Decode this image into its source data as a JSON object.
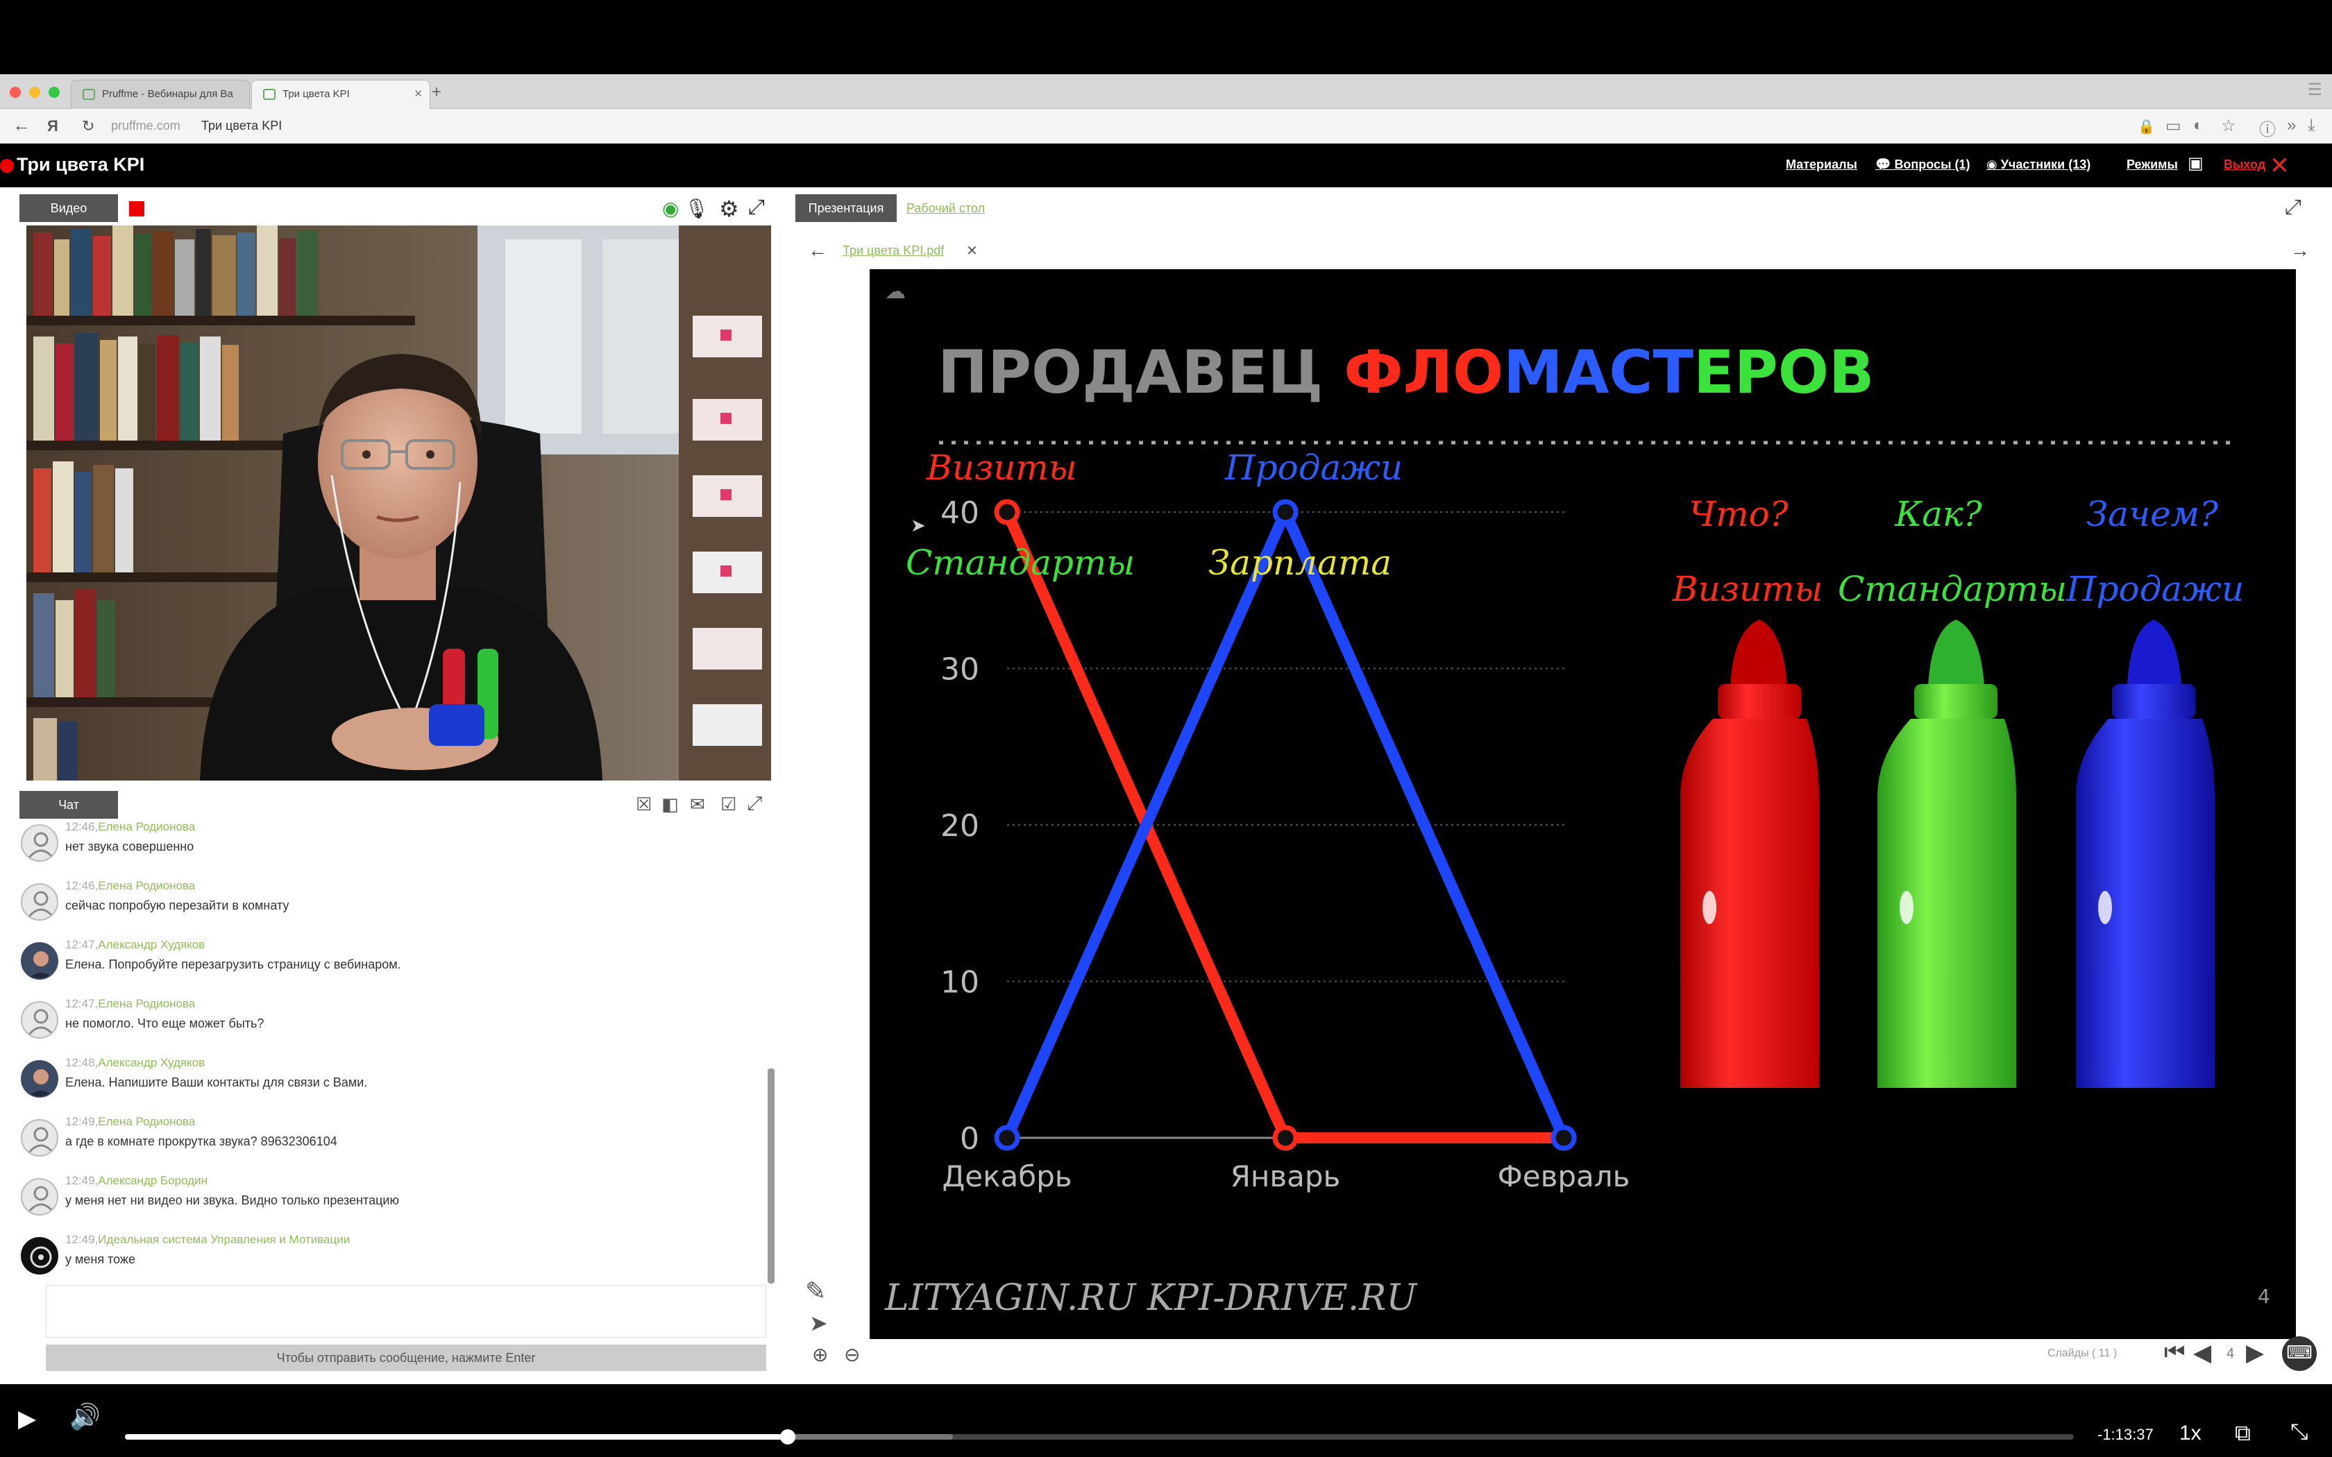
{
  "browser": {
    "tabs": [
      {
        "label": "Pruffme - Вебинары для Ва",
        "active": false
      },
      {
        "label": "Три цвета KPI",
        "active": true
      }
    ],
    "address": {
      "domain": "pruffme.com",
      "title": "Три цвета KPI"
    }
  },
  "header": {
    "title": "Три цвета KPI",
    "links": {
      "materials": "Материалы",
      "questions": "Вопросы (1)",
      "participants": "Участники (13)",
      "modes": "Режимы",
      "exit": "Выход"
    }
  },
  "video_panel": {
    "tab": "Видео"
  },
  "chat": {
    "tab": "Чат",
    "messages": [
      {
        "time": "12:46,",
        "author": "Елена Родионова",
        "text": "нет звука совершенно",
        "avatar": "default"
      },
      {
        "time": "12:46,",
        "author": "Елена Родионова",
        "text": "сейчас попробую перезайти в комнату",
        "avatar": "default"
      },
      {
        "time": "12:47,",
        "author": "Александр Худяков",
        "text": "Елена. Попробуйте перезагрузить страницу с вебинаром.",
        "avatar": "photo"
      },
      {
        "time": "12:47,",
        "author": "Елена Родионова",
        "text": "не помогло. Что еще может быть?",
        "avatar": "default"
      },
      {
        "time": "12:48,",
        "author": "Александр Худяков",
        "text": "Елена. Напишите Ваши контакты для связи с Вами.",
        "avatar": "photo"
      },
      {
        "time": "12:49,",
        "author": "Елена Родионова",
        "text": "а где в комнате прокрутка звука? 89632306104",
        "avatar": "default"
      },
      {
        "time": "12:49,",
        "author": "Александр Бородин",
        "text": "у меня нет ни видео ни звука. Видно только презентацию",
        "avatar": "default"
      },
      {
        "time": "12:49,",
        "author": "Идеальная система Управления и Мотивации",
        "text": "у меня тоже",
        "avatar": "logo"
      }
    ],
    "send_hint": "Чтобы отправить сообщение, нажмите Enter"
  },
  "presentation": {
    "tabs": {
      "presentation": "Презентация",
      "desktop": "Рабочий стол"
    },
    "file_name": "Три цвета KPI.pdf",
    "slide": {
      "title_parts": [
        {
          "text": "ПРОДАВЕЦ ",
          "color": "#8a8a8a"
        },
        {
          "text": "ФЛО",
          "color": "#ff2a1a"
        },
        {
          "text": "МАСТ",
          "color": "#2a5cff"
        },
        {
          "text": "ЕРОВ",
          "color": "#3ce23c"
        }
      ],
      "labels": {
        "visits": "Визиты",
        "sales": "Продажи",
        "standards": "Стандарты",
        "salary": "Зарплата"
      },
      "questions": [
        {
          "q": "Что?",
          "a": "Визиты",
          "color": "#ff2a1a"
        },
        {
          "q": "Как?",
          "a": "Стандарты",
          "color": "#3ce23c"
        },
        {
          "q": "Зачем?",
          "a": "Продажи",
          "color": "#2a5cff"
        }
      ],
      "footer": "LITYAGIN.RU  KPI-DRIVE.RU",
      "page_number": "4"
    },
    "slides_counter": "Слайды ( 11 )",
    "current_page": "4"
  },
  "chart_data": {
    "type": "line",
    "categories": [
      "Декабрь",
      "Январь",
      "Февраль"
    ],
    "ylim": [
      0,
      40
    ],
    "yticks": [
      "0",
      "10",
      "20",
      "30",
      "40"
    ],
    "series": [
      {
        "name": "Визиты",
        "values": [
          40,
          0,
          0
        ],
        "color": "#ff2a1a"
      },
      {
        "name": "Продажи",
        "values": [
          0,
          40,
          0
        ],
        "color": "#1f46ff"
      }
    ]
  },
  "player": {
    "time_remaining": "-1:13:37",
    "speed": "1x",
    "progress": 0.34,
    "buffered": 0.425
  }
}
